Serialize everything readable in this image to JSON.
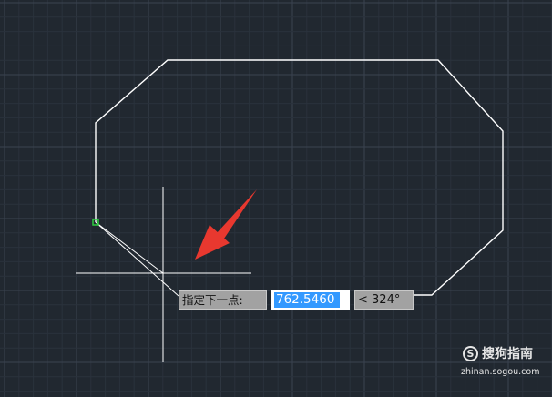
{
  "colors": {
    "background": "#212830",
    "grid_minor": "#2a323c",
    "grid_major": "#3b4350",
    "geometry": "#ffffff",
    "crosshair": "#ffffff",
    "endpoint_marker": "#2ecc40",
    "arrow": "#e8382f",
    "input_selection": "#3399ff"
  },
  "dynamic_input": {
    "prompt": "指定下一点:",
    "length_value": "762.5460",
    "angle_value": "< 324°"
  },
  "watermark": {
    "logo_glyph": "S",
    "name": "搜狗指南",
    "domain": "zhinan.sogou.com"
  },
  "icons": {
    "cursor": "crosshair-cursor-icon",
    "annotation": "red-arrow-icon"
  }
}
